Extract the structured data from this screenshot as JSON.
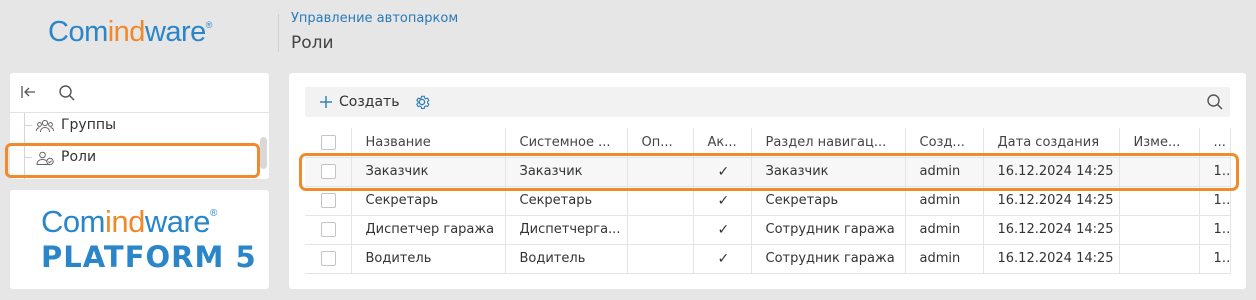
{
  "header": {
    "logo_part1": "Com",
    "logo_part2": "ind",
    "logo_part3": "ware",
    "logo_mark": "®",
    "breadcrumb": "Управление автопарком",
    "title": "Роли"
  },
  "sidebar": {
    "collapse_icon": "collapse-left-icon",
    "search_icon": "search-icon",
    "items": [
      {
        "label": "Группы",
        "icon": "groups-icon"
      },
      {
        "label": "Роли",
        "icon": "role-icon"
      }
    ]
  },
  "brand": {
    "line1_part1": "Com",
    "line1_part2": "ind",
    "line1_part3": "ware",
    "mark": "®",
    "line2": "PLATFORM 5"
  },
  "toolbar": {
    "create_label": "Создать",
    "settings_icon": "gear-icon",
    "search_icon": "search-icon"
  },
  "table": {
    "columns": [
      "Название",
      "Системное ...",
      "Оп...",
      "Ак...",
      "Раздел навигац...",
      "Созд...",
      "Дата создания",
      "Изме...",
      "..."
    ],
    "rows": [
      {
        "name": "Заказчик",
        "system": "Заказчик",
        "op": "",
        "active": "✓",
        "section": "Заказчик",
        "creator": "admin",
        "created": "16.12.2024 14:25",
        "changed": "",
        "extra": "1..."
      },
      {
        "name": "Секретарь",
        "system": "Секретарь",
        "op": "",
        "active": "✓",
        "section": "Секретарь",
        "creator": "admin",
        "created": "16.12.2024 14:25",
        "changed": "",
        "extra": "1..."
      },
      {
        "name": "Диспетчер гаража",
        "system": "Диспетчерга...",
        "op": "",
        "active": "✓",
        "section": "Сотрудник гаража",
        "creator": "admin",
        "created": "16.12.2024 14:25",
        "changed": "",
        "extra": "1..."
      },
      {
        "name": "Водитель",
        "system": "Водитель",
        "op": "",
        "active": "✓",
        "section": "Сотрудник гаража",
        "creator": "admin",
        "created": "16.12.2024 14:25",
        "changed": "",
        "extra": "1..."
      }
    ]
  },
  "colors": {
    "accent": "#2a7ab8",
    "brand_blue": "#2a86c8",
    "brand_orange": "#f0892a",
    "highlight": "#f08a2c"
  }
}
